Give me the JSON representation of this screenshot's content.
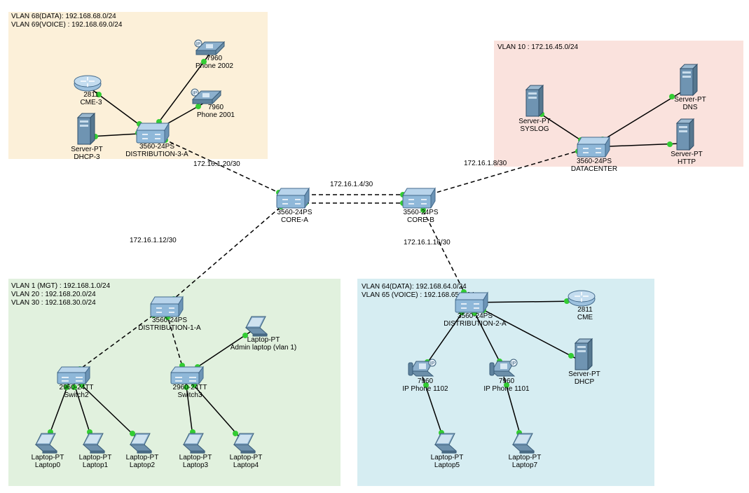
{
  "zones": {
    "orange": {
      "labels": [
        "VLAN 68(DATA): 192.168.68.0/24",
        "VLAN 69(VOICE) : 192.168.69.0/24"
      ]
    },
    "pink": {
      "labels": [
        "VLAN 10 : 172.16.45.0/24"
      ]
    },
    "green": {
      "labels": [
        "VLAN 1 (MGT) : 192.168.1.0/24",
        "VLAN 20 : 192.168.20.0/24",
        "VLAN 30 : 192.168.30.0/24"
      ]
    },
    "blue": {
      "labels": [
        "VLAN 64(DATA): 192.168.64.0/24",
        "VLAN 65 (VOICE) : 192.168.65.0/24"
      ]
    }
  },
  "link_labels": {
    "l1": "172.16.1.20/30",
    "l2": "172.16.1.4/30",
    "l3": "172.16.1.8/30",
    "l4": "172.16.1.12/30",
    "l5": "172.16.1.16/30"
  },
  "devices": {
    "phone2002": {
      "type": "ipphone-top",
      "line1": "7960",
      "line2": "Phone 2002"
    },
    "phone2001": {
      "type": "ipphone-top",
      "line1": "7960",
      "line2": "Phone 2001"
    },
    "cme3": {
      "type": "router",
      "line1": "2811",
      "line2": "CME-3"
    },
    "dhcp3": {
      "type": "server",
      "line1": "Server-PT",
      "line2": "DHCP-3"
    },
    "dist3a": {
      "type": "l3switch",
      "line1": "3560-24PS",
      "line2": "DISTRIBUTION-3-A"
    },
    "syslog": {
      "type": "server",
      "line1": "Server-PT",
      "line2": "SYSLOG"
    },
    "dns": {
      "type": "server",
      "line1": "Server-PT",
      "line2": "DNS"
    },
    "http": {
      "type": "server",
      "line1": "Server-PT",
      "line2": "HTTP"
    },
    "datacenter": {
      "type": "l3switch",
      "line1": "3560-24PS",
      "line2": "DATACENTER"
    },
    "corea": {
      "type": "l3switch",
      "line1": "3560-24PS",
      "line2": "CORE-A"
    },
    "coreb": {
      "type": "l3switch",
      "line1": "3560-24PS",
      "line2": "CORE-B"
    },
    "dist1a": {
      "type": "l3switch",
      "line1": "3560-24PS",
      "line2": "DISTRIBUTION-1-A"
    },
    "sw2": {
      "type": "switch",
      "line1": "2960-24TT",
      "line2": "Switch2"
    },
    "sw3": {
      "type": "switch",
      "line1": "2960-24TT",
      "line2": "Switch3"
    },
    "admin": {
      "type": "laptop",
      "line1": "Laptop-PT",
      "line2": "Admin laptop (vlan 1)"
    },
    "lap0": {
      "type": "laptop",
      "line1": "Laptop-PT",
      "line2": "Laptop0"
    },
    "lap1": {
      "type": "laptop",
      "line1": "Laptop-PT",
      "line2": "Laptop1"
    },
    "lap2": {
      "type": "laptop",
      "line1": "Laptop-PT",
      "line2": "Laptop2"
    },
    "lap3": {
      "type": "laptop",
      "line1": "Laptop-PT",
      "line2": "Laptop3"
    },
    "lap4": {
      "type": "laptop",
      "line1": "Laptop-PT",
      "line2": "Laptop4"
    },
    "dist2a": {
      "type": "l3switch",
      "line1": "3560-24PS",
      "line2": "DISTRIBUTION-2-A"
    },
    "cme": {
      "type": "router",
      "line1": "2811",
      "line2": "CME"
    },
    "dhcp": {
      "type": "server",
      "line1": "Server-PT",
      "line2": "DHCP"
    },
    "ph1102": {
      "type": "ipphone",
      "line1": "7960",
      "line2": "IP Phone 1102"
    },
    "ph1101": {
      "type": "ipphone",
      "line1": "7960",
      "line2": "IP Phone 1101"
    },
    "lap5": {
      "type": "laptop",
      "line1": "Laptop-PT",
      "line2": "Laptop5"
    },
    "lap7": {
      "type": "laptop",
      "line1": "Laptop-PT",
      "line2": "Laptop7"
    }
  }
}
